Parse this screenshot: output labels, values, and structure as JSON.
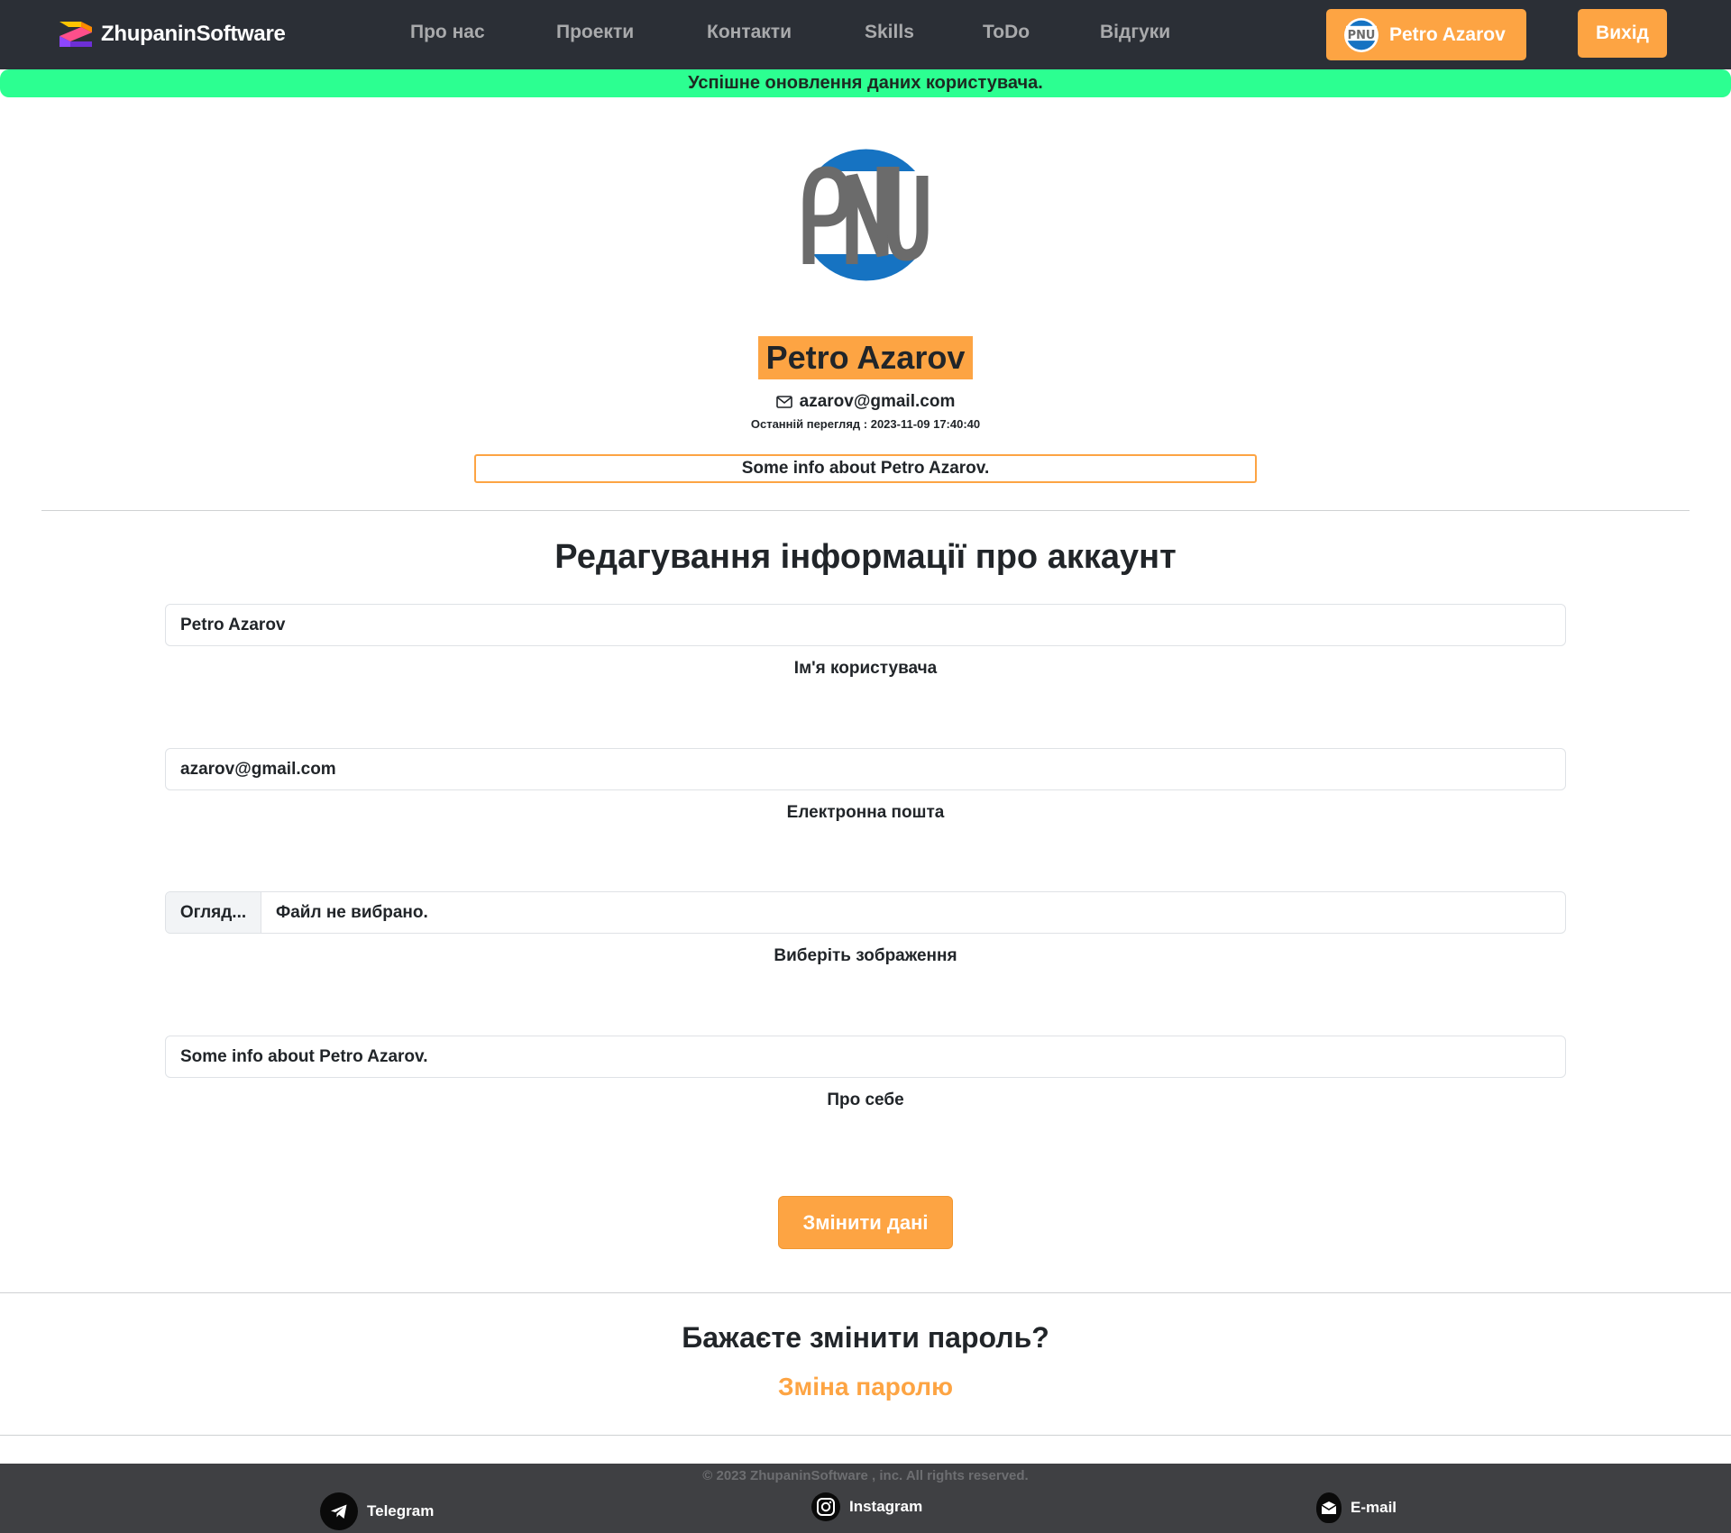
{
  "nav": {
    "brand": "ZhupaninSoftware",
    "links": [
      "Про нас",
      "Проекти",
      "Контакти",
      "Skills",
      "ToDo",
      "Відгуки"
    ],
    "user_name": "Petro Azarov",
    "logout": "Вихід"
  },
  "alert": {
    "text": "Успішне оновлення даних користувача."
  },
  "profile": {
    "name": "Petro Azarov",
    "email": "azarov@gmail.com",
    "last_seen": "Останній перегляд : 2023-11-09 17:40:40",
    "about": "Some info about Petro Azarov."
  },
  "form": {
    "title": "Редагування інформації про аккаунт",
    "username_value": "Petro Azarov",
    "username_label": "Ім'я користувача",
    "email_value": "azarov@gmail.com",
    "email_label": "Електронна пошта",
    "file_button": "Огляд...",
    "file_status": "Файл не вибрано.",
    "file_label": "Виберіть зображення",
    "about_value": "Some info about Petro Azarov.",
    "about_label": "Про себе",
    "submit": "Змінити дані"
  },
  "password": {
    "title": "Бажаєте змінити пароль?",
    "link": "Зміна паролю"
  },
  "footer": {
    "copyright": "© 2023 ZhupaninSoftware , inc. All rights reserved.",
    "telegram": "Telegram",
    "instagram": "Instagram",
    "email": "E-mail"
  },
  "colors": {
    "navbar": "#2b2f36",
    "accent": "#fda443",
    "alert": "#2cff91",
    "footer": "#3f4043",
    "avatar_blue": "#1673c2",
    "avatar_gray": "#6b6b6b"
  },
  "icons": [
    "brand-logo-icon",
    "envelope-icon",
    "telegram-icon",
    "instagram-icon",
    "email-icon"
  ]
}
